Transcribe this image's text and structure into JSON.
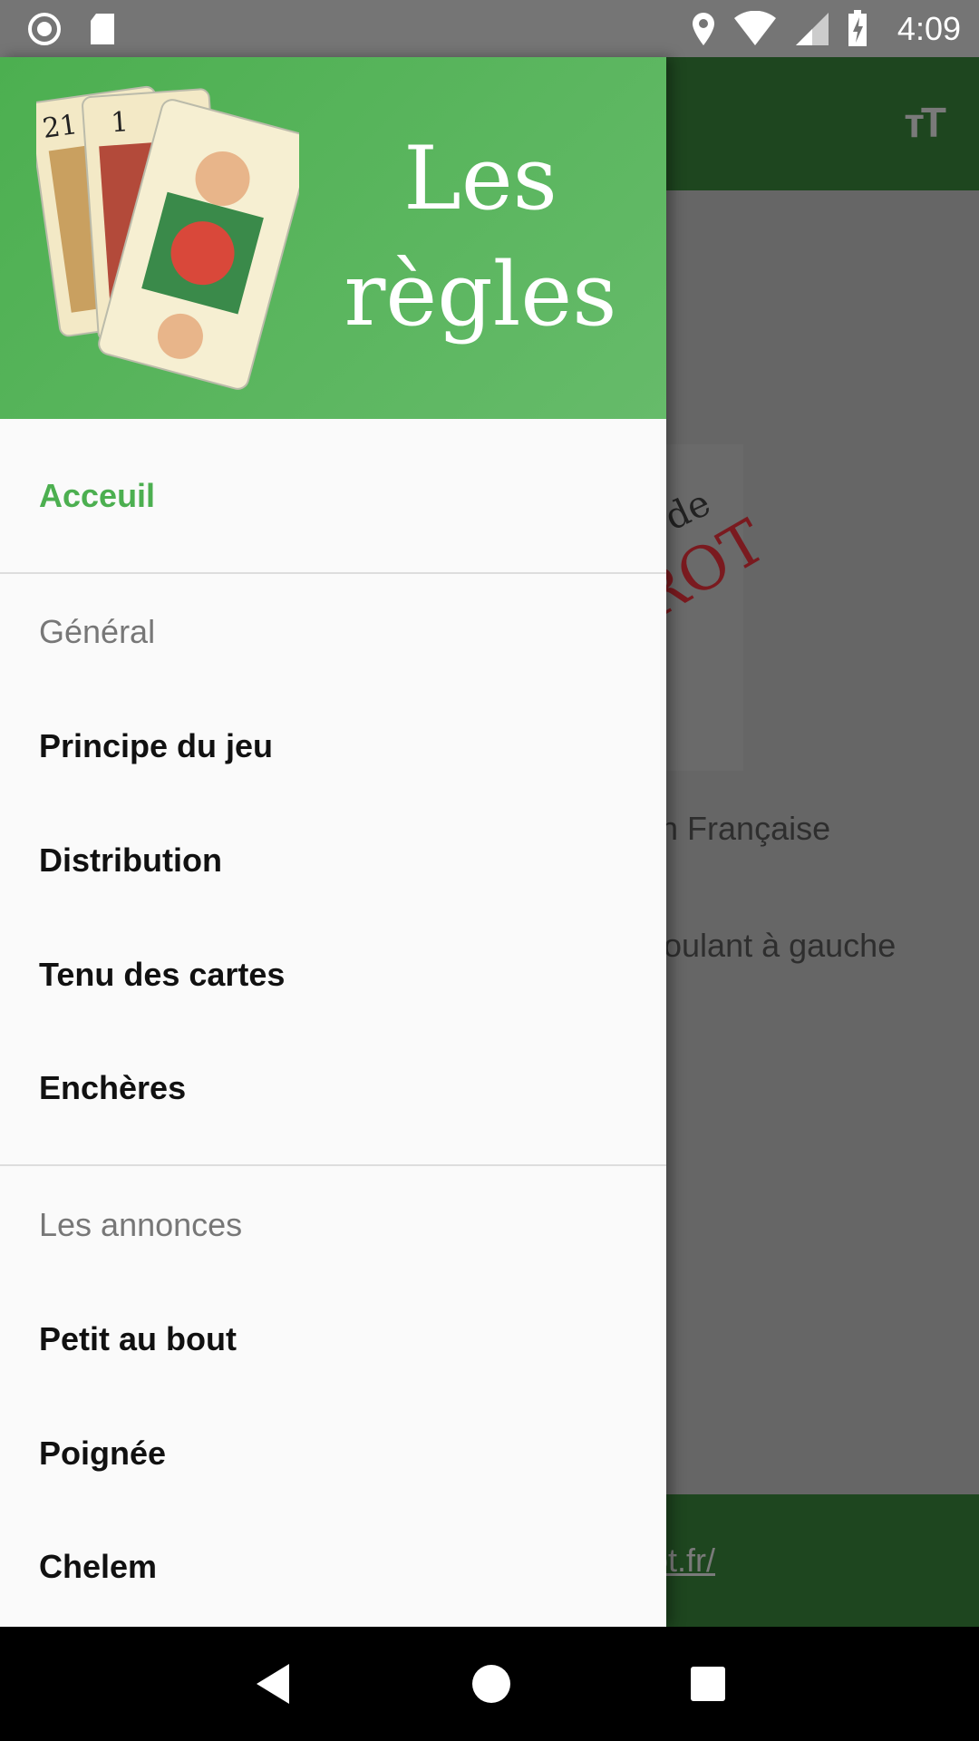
{
  "status_bar": {
    "time": "4:09",
    "icons": [
      "record-icon",
      "sd-card-icon",
      "location-icon",
      "wifi-icon",
      "signal-icon",
      "battery-charging-icon"
    ]
  },
  "background": {
    "toolbar_icon": "text-size-icon",
    "logo_text_de": "de",
    "logo_text_rot": "ROT",
    "line1": "ion Française",
    "line2": "éroulant à gauche",
    "footer_link": "rot.fr/"
  },
  "drawer": {
    "header_title_line1": "Les",
    "header_title_line2": "règles",
    "home": "Acceuil",
    "sections": [
      {
        "title": "Général",
        "items": [
          "Principe du jeu",
          "Distribution",
          "Tenu des cartes",
          "Enchères"
        ]
      },
      {
        "title": "Les annonces",
        "items": [
          "Petit au bout",
          "Poignée",
          "Chelem"
        ]
      }
    ]
  },
  "colors": {
    "accent": "#4caf50",
    "toolbar": "#1e461f"
  },
  "nav_bar": {
    "icons": [
      "back-icon",
      "home-icon",
      "recents-icon"
    ]
  }
}
